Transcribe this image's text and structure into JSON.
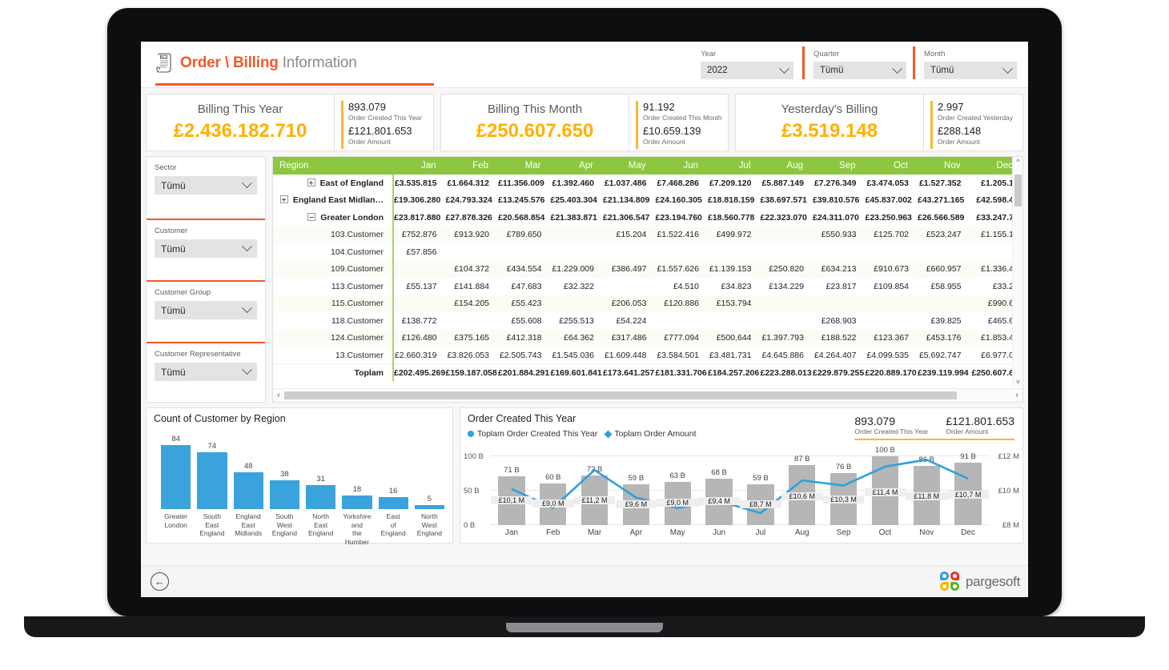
{
  "header": {
    "title_part1": "Order \\ Billing",
    "title_part2": "Information",
    "icon": "bill-scroll-icon",
    "accent_color": "#f15a29",
    "filters": [
      {
        "label": "Year",
        "value": "2022"
      },
      {
        "label": "Quarter",
        "value": "Tümü"
      },
      {
        "label": "Month",
        "value": "Tümü"
      }
    ]
  },
  "kpis": [
    {
      "title": "Billing This Year",
      "value": "£2.436.182.710",
      "side_count": "893.079",
      "side_count_label": "Order Created This Year",
      "side_amount": "£121.801.653",
      "side_amount_label": "Order Amount"
    },
    {
      "title": "Billing This Month",
      "value": "£250.607.650",
      "side_count": "91.192",
      "side_count_label": "Order Created This Month",
      "side_amount": "£10.659.139",
      "side_amount_label": "Order Amount"
    },
    {
      "title": "Yesterday's Billing",
      "value": "£3.519.148",
      "side_count": "2.997",
      "side_count_label": "Order Created Yesterday",
      "side_amount": "£288.148",
      "side_amount_label": "Order Amount"
    }
  ],
  "slicers": [
    {
      "label": "Sector",
      "value": "Tümü"
    },
    {
      "label": "Customer",
      "value": "Tümü"
    },
    {
      "label": "Customer Group",
      "value": "Tümü"
    },
    {
      "label": "Customer Representative",
      "value": "Tümü"
    }
  ],
  "matrix": {
    "header_color": "#8dc63f",
    "columns": [
      "Region",
      "Jan",
      "Feb",
      "Mar",
      "Apr",
      "May",
      "Jun",
      "Jul",
      "Aug",
      "Sep",
      "Oct",
      "Nov",
      "Dec"
    ],
    "rows": [
      {
        "level": 0,
        "toggle": "plus",
        "region": "East of England",
        "values": [
          "£3.535.815",
          "£1.664.312",
          "£11.356.009",
          "£1.392.460",
          "£1.037.486",
          "£7.468.286",
          "£7.209.120",
          "£5.887.149",
          "£7.276.349",
          "£3.474.053",
          "£1.527.352",
          "£1.205.1"
        ]
      },
      {
        "level": 0,
        "toggle": "plus",
        "region": "England East Midlan…",
        "values": [
          "£19.306.280",
          "£24.793.324",
          "£13.245.576",
          "£25.403.304",
          "£21.134.809",
          "£24.160.305",
          "£18.818.159",
          "£38.697.571",
          "£39.810.576",
          "£45.837.002",
          "£43.271.165",
          "£42.598.4"
        ]
      },
      {
        "level": 0,
        "toggle": "minus",
        "region": "Greater London",
        "values": [
          "£23.817.880",
          "£27.878.326",
          "£20.568.854",
          "£21.383.871",
          "£21.306.547",
          "£23.194.760",
          "£18.560.778",
          "£22.323.070",
          "£24.311.070",
          "£23.250.963",
          "£26.566.589",
          "£33.247.7"
        ]
      },
      {
        "level": 1,
        "region": "103.Customer",
        "values": [
          "£752.876",
          "£913.920",
          "£789.650",
          "",
          "£15.204",
          "£1.522.416",
          "£499.972",
          "",
          "£550.933",
          "£125.702",
          "£523.247",
          "£1.155.1"
        ]
      },
      {
        "level": 1,
        "region": "104.Customer",
        "values": [
          "£57.856",
          "",
          "",
          "",
          "",
          "",
          "",
          "",
          "",
          "",
          "",
          ""
        ]
      },
      {
        "level": 1,
        "region": "109.Customer",
        "values": [
          "",
          "£104.372",
          "£434.554",
          "£1.229.009",
          "£386.497",
          "£1.557.626",
          "£1.139.153",
          "£250.820",
          "£634.213",
          "£910.673",
          "£660.957",
          "£1.336.4"
        ]
      },
      {
        "level": 1,
        "region": "113.Customer",
        "values": [
          "£55.137",
          "£141.884",
          "£47.683",
          "£32.322",
          "",
          "£4.510",
          "£34.823",
          "£134.229",
          "£23.817",
          "£109.854",
          "£58.955",
          "£33.2"
        ]
      },
      {
        "level": 1,
        "region": "115.Customer",
        "values": [
          "",
          "£154.205",
          "£55.423",
          "",
          "£206.053",
          "£120.886",
          "£153.794",
          "",
          "",
          "",
          "",
          "£990.6"
        ]
      },
      {
        "level": 1,
        "region": "118.Customer",
        "values": [
          "£138.772",
          "",
          "£55.608",
          "£255.513",
          "£54.224",
          "",
          "",
          "",
          "£268.903",
          "",
          "£39.825",
          "£465.6"
        ]
      },
      {
        "level": 1,
        "region": "124.Customer",
        "values": [
          "£126.480",
          "£375.165",
          "£412.318",
          "£64.362",
          "£317.486",
          "£777.094",
          "£500.644",
          "£1.397.793",
          "£188.522",
          "£123.367",
          "£453.176",
          "£1.853.4"
        ]
      },
      {
        "level": 1,
        "highlight": true,
        "region": "13.Customer",
        "values": [
          "£2.660.319",
          "£3.826.053",
          "£2.505.743",
          "£1.545.036",
          "£1.609.448",
          "£3.584.501",
          "£3.481.731",
          "£4.645.886",
          "£4.264.407",
          "£4.099.535",
          "£5.692.747",
          "£6.977.0"
        ]
      }
    ],
    "total_row": {
      "label": "Toplam",
      "values": [
        "£202.495.269",
        "£159.187.058",
        "£201.884.291",
        "£169.601.841",
        "£173.641.257",
        "£181.331.706",
        "£184.257.206",
        "£223.288.013",
        "£229.879.255",
        "£220.889.170",
        "£239.119.994",
        "£250.607.6"
      ]
    }
  },
  "chart_data": [
    {
      "type": "bar",
      "title": "Count of Customer by Region",
      "xlabel": "",
      "ylabel": "",
      "ylim": [
        0,
        90
      ],
      "grid": false,
      "bar_color": "#3aa3dd",
      "categories": [
        "Greater London",
        "South East England",
        "England East Midlands",
        "South West England",
        "North East England",
        "Yorkshire and the Humber",
        "East of England",
        "North West England"
      ],
      "values": [
        84,
        74,
        48,
        38,
        31,
        18,
        16,
        5
      ]
    },
    {
      "type": "bar",
      "title": "Order Created This Year",
      "legend": [
        "Toplam Order Created This Year",
        "Toplam Order Amount"
      ],
      "legend_position": "top-left",
      "kpi_count": "893.079",
      "kpi_count_label": "Order Created This Year",
      "kpi_amount": "£121.801.653",
      "kpi_amount_label": "Order Amount",
      "categories": [
        "Jan",
        "Feb",
        "Mar",
        "Apr",
        "May",
        "Jun",
        "Jul",
        "Aug",
        "Sep",
        "Oct",
        "Nov",
        "Dec"
      ],
      "yaxis_left_ticks": [
        "0 B",
        "50 B",
        "100 B"
      ],
      "yaxis_right_ticks": [
        "£8 M",
        "£10 M",
        "£12 M"
      ],
      "ylim_left": [
        0,
        100
      ],
      "ylim_right": [
        8,
        12
      ],
      "bar_color": "#b6b6b6",
      "line_color": "#2f9fe0",
      "series": [
        {
          "name": "Toplam Order Created This Year",
          "kind": "bar",
          "values": [
            71,
            60,
            72,
            59,
            63,
            68,
            59,
            87,
            76,
            100,
            86,
            91
          ],
          "labels": [
            "71 B",
            "60 B",
            "72 B",
            "59 B",
            "63 B",
            "68 B",
            "59 B",
            "87 B",
            "76 B",
            "100 B",
            "86 B",
            "91 B"
          ]
        },
        {
          "name": "Toplam Order Amount",
          "kind": "line",
          "values": [
            10.1,
            9.0,
            11.2,
            9.6,
            9.0,
            9.4,
            8.7,
            10.6,
            10.3,
            11.4,
            11.8,
            10.7
          ],
          "labels": [
            "£10,1 M",
            "£9,0 M",
            "£11,2 M",
            "£9,6 M",
            "£9,0 M",
            "£9,4 M",
            "£8,7 M",
            "£10,6 M",
            "£10,3 M",
            "£11,4 M",
            "£11,8 M",
            "£10,7 M"
          ]
        }
      ]
    }
  ],
  "footer": {
    "back_icon": "back-arrow-icon",
    "brand_name": "pargesoft",
    "brand_colors": [
      "#2f9fe0",
      "#e8342a",
      "#f5b400",
      "#5cb531"
    ]
  }
}
